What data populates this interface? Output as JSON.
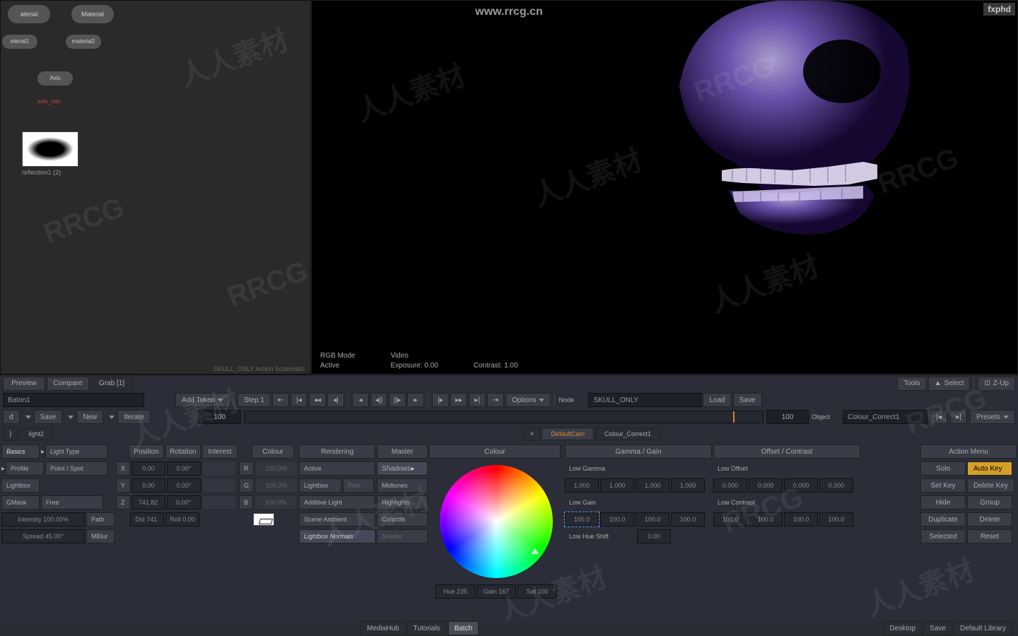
{
  "watermarks": {
    "url": "www.rrcg.cn",
    "fx": "fxphd",
    "rrcg": "RRCG",
    "cn": "人人素材"
  },
  "schematic": {
    "footer": "SKULL_ONLY Action Schematic",
    "nodes": {
      "mat1": "aterial",
      "mat2": "Material",
      "sub1": "eterial1",
      "sub2": "material2",
      "axis": "Axis",
      "red": "axis_roto"
    },
    "thumb": "reflection1 (2)"
  },
  "viewport": {
    "rgb": "RGB Mode",
    "video": "Video",
    "active": "Active",
    "exposure": "Exposure: 0.00",
    "contrast": "Contrast: 1.00"
  },
  "toolbar1": {
    "preview": "Preview",
    "compare": "Compare",
    "grab": "Grab [1]",
    "tools": "Tools",
    "select": "Select",
    "zup": "Z-Up"
  },
  "toolbar2": {
    "batch": "Baton1",
    "addtoken": "Add Token",
    "step": "Step 1",
    "options": "Options",
    "node_lbl": "Node",
    "node_val": "SKULL_ONLY",
    "load": "Load",
    "save": "Save"
  },
  "toolbar3": {
    "d": "d",
    "save": "Save",
    "new": "New",
    "iterate": "Iterate",
    "frame_start": "100",
    "frame_end": "100",
    "object_lbl": "Object",
    "object_val": "Colour_Correct1",
    "presets": "Presets"
  },
  "tabrow": {
    "t1": "",
    "t2": "light2",
    "close": "×",
    "cam": "DefaultCam",
    "cc": "Colour_Correct1"
  },
  "left_params": {
    "basics": "Basics",
    "lighttype": "Light Type",
    "profile": "Profile",
    "pointspot": "Point / Spot",
    "lightbox": "Lightbox",
    "gmask": "GMask",
    "free": "Free",
    "intensity": "Intensity 100.00%",
    "path": "Path",
    "spread": "Spread 45.00°",
    "mblur": "MBlur"
  },
  "xyz": {
    "headers": [
      "Position",
      "Rotation",
      "Interest"
    ],
    "x": {
      "lbl": "X",
      "v1": "0.00",
      "v2": "0.00°",
      "v3": ""
    },
    "y": {
      "lbl": "Y",
      "v1": "0.00",
      "v2": "0.00°",
      "v3": ""
    },
    "z": {
      "lbl": "Z",
      "v1": "741.82",
      "v2": "0.00°",
      "v3": ""
    },
    "dist": {
      "lbl": "",
      "v1": "Dst 741.",
      "v2": "Roll 0.00"
    }
  },
  "rgb": {
    "colour": "Colour",
    "r": {
      "lbl": "R",
      "v": "100.0%"
    },
    "g": {
      "lbl": "G",
      "v": "100.0%"
    },
    "b": {
      "lbl": "B",
      "v": "100.0%"
    }
  },
  "rendering": {
    "head": "Rendering",
    "active": "Active",
    "lightbox": "Lightbox",
    "post": "Post",
    "additive": "Additive Light",
    "ambient": "Scene Ambient",
    "normals": "Lightbox Normals"
  },
  "master": {
    "head": "Master",
    "shadows": "Shadows",
    "midtones": "Midtones",
    "highlights": "Highlights",
    "controls": "Controls",
    "shader": "Shader"
  },
  "colour": {
    "head": "Colour",
    "hue": "Hue 235",
    "gain": "Gain 167",
    "sat": "Sat 100"
  },
  "gamma": {
    "head": "Gamma / Gain",
    "lowgamma": "Low Gamma",
    "gv": [
      "1.000",
      "1.000",
      "1.000",
      "1.000"
    ],
    "lowgain": "Low Gain",
    "gnv": [
      "100.0",
      "100.0",
      "100.0",
      "100.0"
    ],
    "lowhue": "Low Hue Shift",
    "huev": "0.00"
  },
  "offset": {
    "head": "Offset / Contrast",
    "lowoffset": "Low Offset",
    "ov": [
      "0.000",
      "0.000",
      "0.000",
      "0.000"
    ],
    "lowcontrast": "Low Contrast",
    "cv": [
      "100.0",
      "100.0",
      "100.0",
      "100.0"
    ]
  },
  "action": {
    "head": "Action Menu",
    "solo": "Solo",
    "autokey": "Auto Key",
    "setkey": "Set Key",
    "delkey": "Delete Key",
    "hide": "Hide",
    "group": "Group",
    "dup": "Duplicate",
    "delete": "Delete",
    "selected": "Selected",
    "reset": "Reset"
  },
  "bottom": {
    "mediahub": "MediaHub",
    "tutorials": "Tutorials",
    "batch": "Batch",
    "desktop": "Desktop",
    "save": "Save",
    "deflib": "Default Library"
  }
}
